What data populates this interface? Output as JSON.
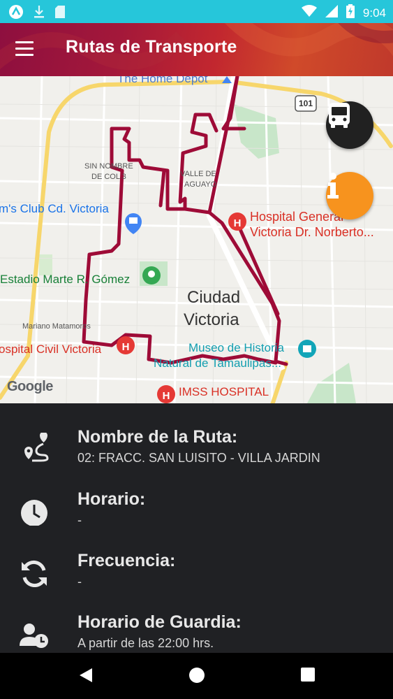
{
  "status_bar": {
    "time": "9:04",
    "icons": [
      "app-icon",
      "download-icon",
      "sim-card-icon",
      "wifi-icon",
      "signal-icon",
      "battery-charging-icon"
    ]
  },
  "app_bar": {
    "title": "Rutas de Transporte",
    "menu_icon": "hamburger-menu-icon"
  },
  "map": {
    "labels": {
      "home_depot": "The Home Depot",
      "highway": "101",
      "sin_nombre_1": "SIN NOMBRE",
      "sin_nombre_2": "DE COL 3",
      "valle_1": "VALLE DE",
      "valle_2": "AGUAYO",
      "sams_club": "m's Club Cd. Victoria",
      "hospital_general_1": "Hospital General",
      "hospital_general_2": "Victoria Dr. Norberto...",
      "estadio": "Estadio Marte R. Gómez",
      "city_1": "Ciudad",
      "city_2": "Victoria",
      "mariano": "Mariano Matamoros",
      "hospital_civil": "ospital Civil Victoria",
      "museo_1": "Museo de Historia",
      "museo_2": "Natural de Tamaulipas...",
      "imss": "IMSS HOSPITAL",
      "google": "Google"
    },
    "route_color": "#9e0b37",
    "buttons": {
      "bus": {
        "icon": "bus-icon",
        "color": "#212121"
      },
      "info": {
        "icon": "info-icon",
        "color": "#f7931e"
      }
    }
  },
  "details": {
    "route_name": {
      "icon": "route-icon",
      "label": "Nombre de la Ruta:",
      "value": "02: FRACC. SAN LUISITO - VILLA JARDIN"
    },
    "schedule": {
      "icon": "clock-icon",
      "label": "Horario:",
      "value": "-"
    },
    "frequency": {
      "icon": "sync-icon",
      "label": "Frecuencia:",
      "value": "-"
    },
    "guard_schedule": {
      "icon": "user-clock-icon",
      "label": "Horario de Guardia:",
      "value": "A partir de las 22:00 hrs."
    }
  },
  "nav_bar": {
    "back": "back-icon",
    "home": "home-icon",
    "recents": "recents-icon"
  }
}
